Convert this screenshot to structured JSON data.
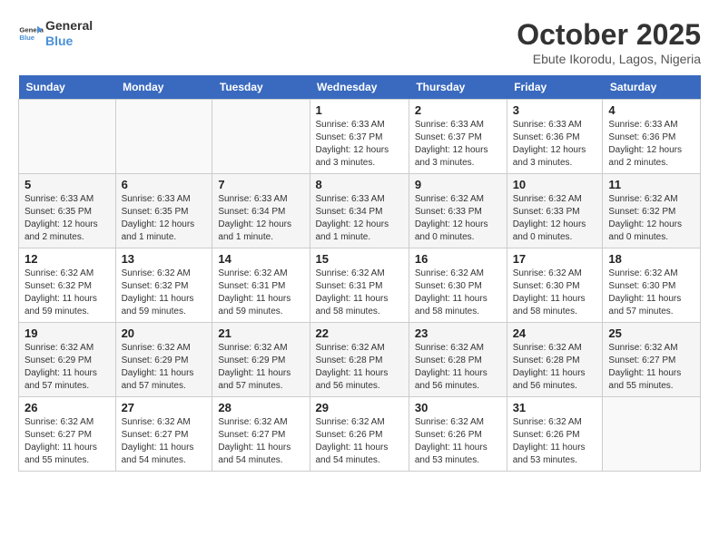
{
  "header": {
    "logo_line1": "General",
    "logo_line2": "Blue",
    "month_year": "October 2025",
    "location": "Ebute Ikorodu, Lagos, Nigeria"
  },
  "weekdays": [
    "Sunday",
    "Monday",
    "Tuesday",
    "Wednesday",
    "Thursday",
    "Friday",
    "Saturday"
  ],
  "weeks": [
    [
      {
        "day": "",
        "info": ""
      },
      {
        "day": "",
        "info": ""
      },
      {
        "day": "",
        "info": ""
      },
      {
        "day": "1",
        "info": "Sunrise: 6:33 AM\nSunset: 6:37 PM\nDaylight: 12 hours\nand 3 minutes."
      },
      {
        "day": "2",
        "info": "Sunrise: 6:33 AM\nSunset: 6:37 PM\nDaylight: 12 hours\nand 3 minutes."
      },
      {
        "day": "3",
        "info": "Sunrise: 6:33 AM\nSunset: 6:36 PM\nDaylight: 12 hours\nand 3 minutes."
      },
      {
        "day": "4",
        "info": "Sunrise: 6:33 AM\nSunset: 6:36 PM\nDaylight: 12 hours\nand 2 minutes."
      }
    ],
    [
      {
        "day": "5",
        "info": "Sunrise: 6:33 AM\nSunset: 6:35 PM\nDaylight: 12 hours\nand 2 minutes."
      },
      {
        "day": "6",
        "info": "Sunrise: 6:33 AM\nSunset: 6:35 PM\nDaylight: 12 hours\nand 1 minute."
      },
      {
        "day": "7",
        "info": "Sunrise: 6:33 AM\nSunset: 6:34 PM\nDaylight: 12 hours\nand 1 minute."
      },
      {
        "day": "8",
        "info": "Sunrise: 6:33 AM\nSunset: 6:34 PM\nDaylight: 12 hours\nand 1 minute."
      },
      {
        "day": "9",
        "info": "Sunrise: 6:32 AM\nSunset: 6:33 PM\nDaylight: 12 hours\nand 0 minutes."
      },
      {
        "day": "10",
        "info": "Sunrise: 6:32 AM\nSunset: 6:33 PM\nDaylight: 12 hours\nand 0 minutes."
      },
      {
        "day": "11",
        "info": "Sunrise: 6:32 AM\nSunset: 6:32 PM\nDaylight: 12 hours\nand 0 minutes."
      }
    ],
    [
      {
        "day": "12",
        "info": "Sunrise: 6:32 AM\nSunset: 6:32 PM\nDaylight: 11 hours\nand 59 minutes."
      },
      {
        "day": "13",
        "info": "Sunrise: 6:32 AM\nSunset: 6:32 PM\nDaylight: 11 hours\nand 59 minutes."
      },
      {
        "day": "14",
        "info": "Sunrise: 6:32 AM\nSunset: 6:31 PM\nDaylight: 11 hours\nand 59 minutes."
      },
      {
        "day": "15",
        "info": "Sunrise: 6:32 AM\nSunset: 6:31 PM\nDaylight: 11 hours\nand 58 minutes."
      },
      {
        "day": "16",
        "info": "Sunrise: 6:32 AM\nSunset: 6:30 PM\nDaylight: 11 hours\nand 58 minutes."
      },
      {
        "day": "17",
        "info": "Sunrise: 6:32 AM\nSunset: 6:30 PM\nDaylight: 11 hours\nand 58 minutes."
      },
      {
        "day": "18",
        "info": "Sunrise: 6:32 AM\nSunset: 6:30 PM\nDaylight: 11 hours\nand 57 minutes."
      }
    ],
    [
      {
        "day": "19",
        "info": "Sunrise: 6:32 AM\nSunset: 6:29 PM\nDaylight: 11 hours\nand 57 minutes."
      },
      {
        "day": "20",
        "info": "Sunrise: 6:32 AM\nSunset: 6:29 PM\nDaylight: 11 hours\nand 57 minutes."
      },
      {
        "day": "21",
        "info": "Sunrise: 6:32 AM\nSunset: 6:29 PM\nDaylight: 11 hours\nand 57 minutes."
      },
      {
        "day": "22",
        "info": "Sunrise: 6:32 AM\nSunset: 6:28 PM\nDaylight: 11 hours\nand 56 minutes."
      },
      {
        "day": "23",
        "info": "Sunrise: 6:32 AM\nSunset: 6:28 PM\nDaylight: 11 hours\nand 56 minutes."
      },
      {
        "day": "24",
        "info": "Sunrise: 6:32 AM\nSunset: 6:28 PM\nDaylight: 11 hours\nand 56 minutes."
      },
      {
        "day": "25",
        "info": "Sunrise: 6:32 AM\nSunset: 6:27 PM\nDaylight: 11 hours\nand 55 minutes."
      }
    ],
    [
      {
        "day": "26",
        "info": "Sunrise: 6:32 AM\nSunset: 6:27 PM\nDaylight: 11 hours\nand 55 minutes."
      },
      {
        "day": "27",
        "info": "Sunrise: 6:32 AM\nSunset: 6:27 PM\nDaylight: 11 hours\nand 54 minutes."
      },
      {
        "day": "28",
        "info": "Sunrise: 6:32 AM\nSunset: 6:27 PM\nDaylight: 11 hours\nand 54 minutes."
      },
      {
        "day": "29",
        "info": "Sunrise: 6:32 AM\nSunset: 6:26 PM\nDaylight: 11 hours\nand 54 minutes."
      },
      {
        "day": "30",
        "info": "Sunrise: 6:32 AM\nSunset: 6:26 PM\nDaylight: 11 hours\nand 53 minutes."
      },
      {
        "day": "31",
        "info": "Sunrise: 6:32 AM\nSunset: 6:26 PM\nDaylight: 11 hours\nand 53 minutes."
      },
      {
        "day": "",
        "info": ""
      }
    ]
  ]
}
